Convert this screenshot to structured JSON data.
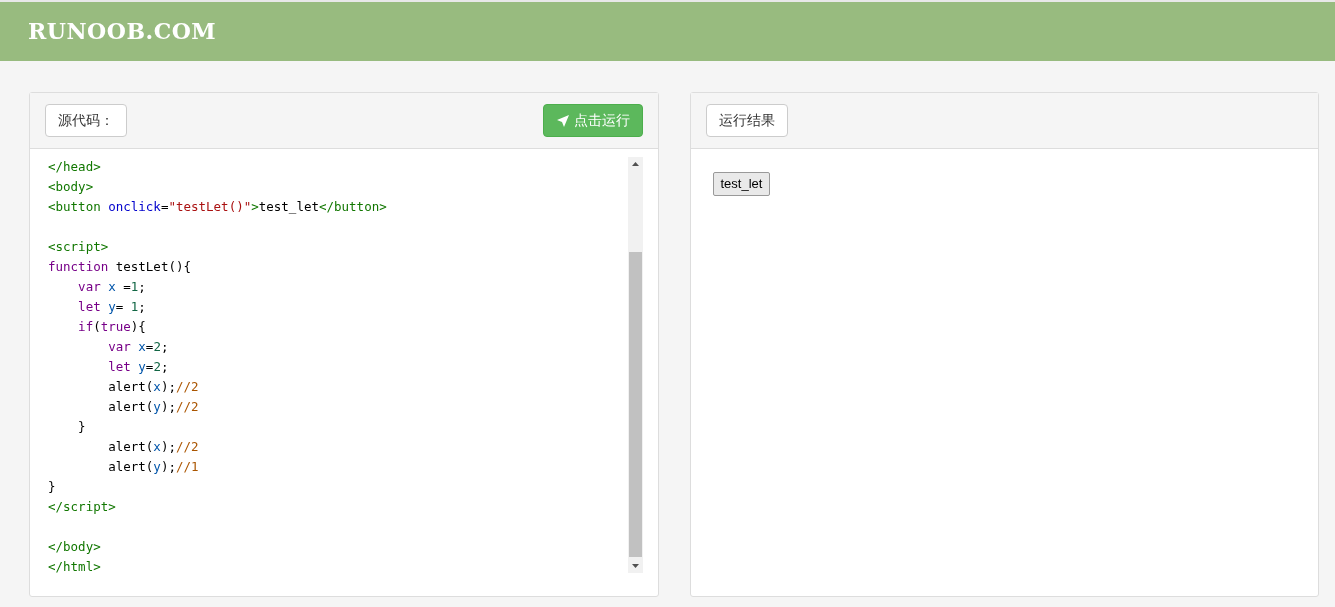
{
  "header": {
    "logo": "RUNOOB.COM"
  },
  "source_panel": {
    "label": "源代码：",
    "run_button": "点击运行",
    "code_lines": [
      {
        "kind": "code",
        "tokens": [
          {
            "kind": "tag",
            "text": "</head>"
          }
        ]
      },
      {
        "kind": "code",
        "tokens": [
          {
            "kind": "tag",
            "text": "<body>"
          }
        ]
      },
      {
        "kind": "code",
        "tokens": [
          {
            "kind": "tag",
            "text": "<button "
          },
          {
            "kind": "attr",
            "text": "onclick"
          },
          {
            "kind": "plain",
            "text": "="
          },
          {
            "kind": "string",
            "text": "\"testLet()\""
          },
          {
            "kind": "tag",
            "text": ">"
          },
          {
            "kind": "plain",
            "text": "test_let"
          },
          {
            "kind": "tag",
            "text": "</button>"
          }
        ]
      },
      {
        "kind": "blank"
      },
      {
        "kind": "code",
        "tokens": [
          {
            "kind": "tag",
            "text": "<script>"
          }
        ]
      },
      {
        "kind": "code",
        "tokens": [
          {
            "kind": "keyword",
            "text": "function "
          },
          {
            "kind": "plain",
            "text": "testLet(){"
          }
        ]
      },
      {
        "kind": "code",
        "tokens": [
          {
            "kind": "keyword",
            "text": "    var "
          },
          {
            "kind": "var",
            "text": "x "
          },
          {
            "kind": "plain",
            "text": "="
          },
          {
            "kind": "number",
            "text": "1"
          },
          {
            "kind": "plain",
            "text": ";"
          }
        ]
      },
      {
        "kind": "code",
        "tokens": [
          {
            "kind": "keyword",
            "text": "    let "
          },
          {
            "kind": "var",
            "text": "y"
          },
          {
            "kind": "plain",
            "text": "= "
          },
          {
            "kind": "number",
            "text": "1"
          },
          {
            "kind": "plain",
            "text": ";"
          }
        ]
      },
      {
        "kind": "code",
        "tokens": [
          {
            "kind": "keyword",
            "text": "    if"
          },
          {
            "kind": "plain",
            "text": "("
          },
          {
            "kind": "keyword",
            "text": "true"
          },
          {
            "kind": "plain",
            "text": "){"
          }
        ]
      },
      {
        "kind": "code",
        "tokens": [
          {
            "kind": "keyword",
            "text": "        var "
          },
          {
            "kind": "var",
            "text": "x"
          },
          {
            "kind": "plain",
            "text": "="
          },
          {
            "kind": "number",
            "text": "2"
          },
          {
            "kind": "plain",
            "text": ";"
          }
        ]
      },
      {
        "kind": "code",
        "tokens": [
          {
            "kind": "keyword",
            "text": "        let "
          },
          {
            "kind": "var",
            "text": "y"
          },
          {
            "kind": "plain",
            "text": "="
          },
          {
            "kind": "number",
            "text": "2"
          },
          {
            "kind": "plain",
            "text": ";"
          }
        ]
      },
      {
        "kind": "code",
        "tokens": [
          {
            "kind": "plain",
            "text": "        alert("
          },
          {
            "kind": "var",
            "text": "x"
          },
          {
            "kind": "plain",
            "text": ");"
          },
          {
            "kind": "comment",
            "text": "//2"
          }
        ]
      },
      {
        "kind": "code",
        "tokens": [
          {
            "kind": "plain",
            "text": "        alert("
          },
          {
            "kind": "var",
            "text": "y"
          },
          {
            "kind": "plain",
            "text": ");"
          },
          {
            "kind": "comment",
            "text": "//2"
          }
        ]
      },
      {
        "kind": "code",
        "tokens": [
          {
            "kind": "plain",
            "text": "    }"
          }
        ]
      },
      {
        "kind": "code",
        "tokens": [
          {
            "kind": "plain",
            "text": "        alert("
          },
          {
            "kind": "var",
            "text": "x"
          },
          {
            "kind": "plain",
            "text": ");"
          },
          {
            "kind": "comment",
            "text": "//2"
          }
        ]
      },
      {
        "kind": "code",
        "tokens": [
          {
            "kind": "plain",
            "text": "        alert("
          },
          {
            "kind": "var",
            "text": "y"
          },
          {
            "kind": "plain",
            "text": ");"
          },
          {
            "kind": "comment",
            "text": "//1"
          }
        ]
      },
      {
        "kind": "code",
        "tokens": [
          {
            "kind": "plain",
            "text": "}"
          }
        ]
      },
      {
        "kind": "code",
        "tokens": [
          {
            "kind": "tag",
            "text": "</script>"
          }
        ]
      },
      {
        "kind": "blank"
      },
      {
        "kind": "code",
        "tokens": [
          {
            "kind": "tag",
            "text": "</body>"
          }
        ]
      },
      {
        "kind": "code",
        "tokens": [
          {
            "kind": "tag",
            "text": "</html>"
          }
        ]
      }
    ]
  },
  "result_panel": {
    "label": "运行结果",
    "output_button": "test_let"
  }
}
